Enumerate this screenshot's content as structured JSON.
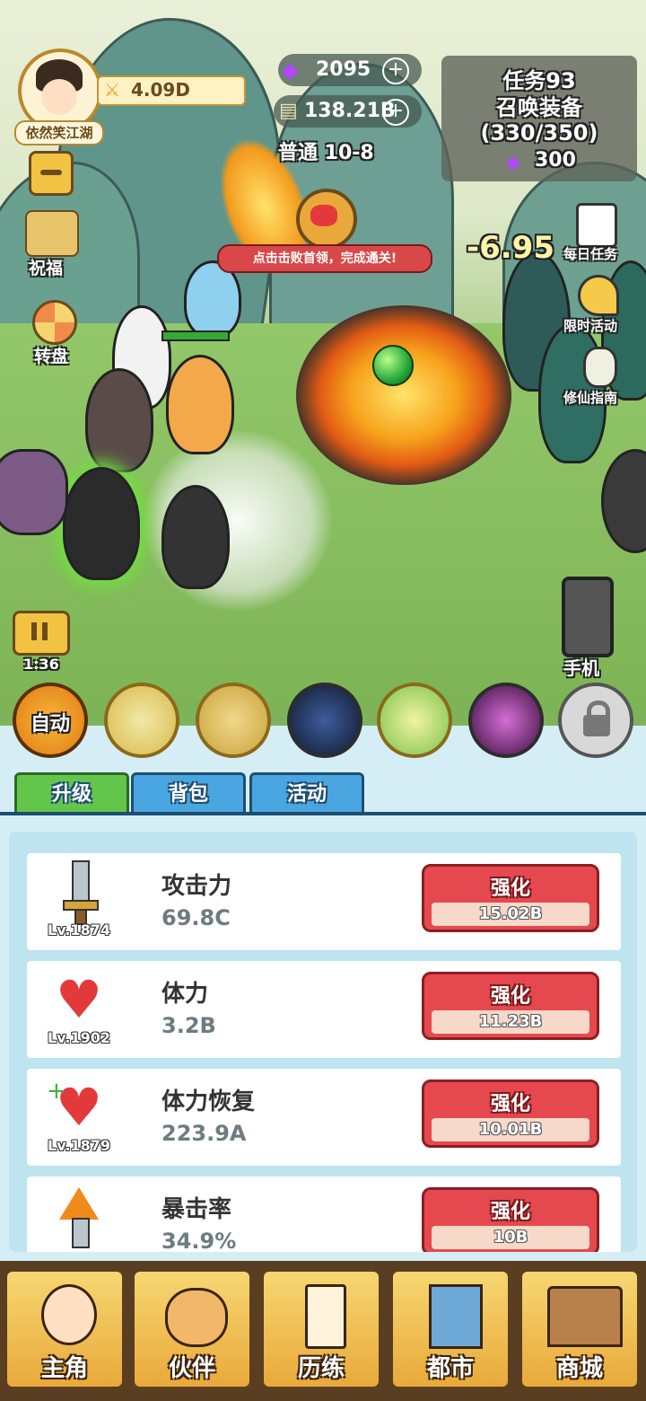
{
  "player": {
    "name": "依然笑江湖",
    "power": "4.09D"
  },
  "currency": {
    "gems": "2095",
    "cash": "138.21B"
  },
  "stage": "普通 10-8",
  "quest": {
    "title": "任务93",
    "name": "召唤装备",
    "progress": "(330/350)",
    "reward": "300"
  },
  "left_menu": {
    "blessing": "祝福",
    "wheel": "转盘"
  },
  "right_menu": {
    "daily": "每日任务",
    "limited": "限时活动",
    "guide": "修仙指南",
    "phone": "手机"
  },
  "boss_tip": "点击击败首领，完成通关!",
  "damage_text": "-6.95",
  "timer": "1:36",
  "skills": {
    "auto": "自动"
  },
  "tabs": [
    "升级",
    "背包",
    "活动"
  ],
  "upgrades": [
    {
      "name": "攻击力",
      "value": "69.8C",
      "level": "Lv.1874",
      "button": "强化",
      "cost": "15.02B",
      "icon": "sword-icon"
    },
    {
      "name": "体力",
      "value": "3.2B",
      "level": "Lv.1902",
      "button": "强化",
      "cost": "11.23B",
      "icon": "heart-icon"
    },
    {
      "name": "体力恢复",
      "value": "223.9A",
      "level": "Lv.1879",
      "button": "强化",
      "cost": "10.01B",
      "icon": "heart-plus-icon"
    },
    {
      "name": "暴击率",
      "value": "34.9%",
      "level": "",
      "button": "强化",
      "cost": "10B",
      "icon": "crit-arrow-icon"
    }
  ],
  "nav": [
    "主角",
    "伙伴",
    "历练",
    "都市",
    "商城"
  ],
  "colors": {
    "accent_red": "#e64850",
    "tab_active": "#62c64b",
    "tab_inactive": "#4aa6e0",
    "gold": "#f2b33a"
  }
}
